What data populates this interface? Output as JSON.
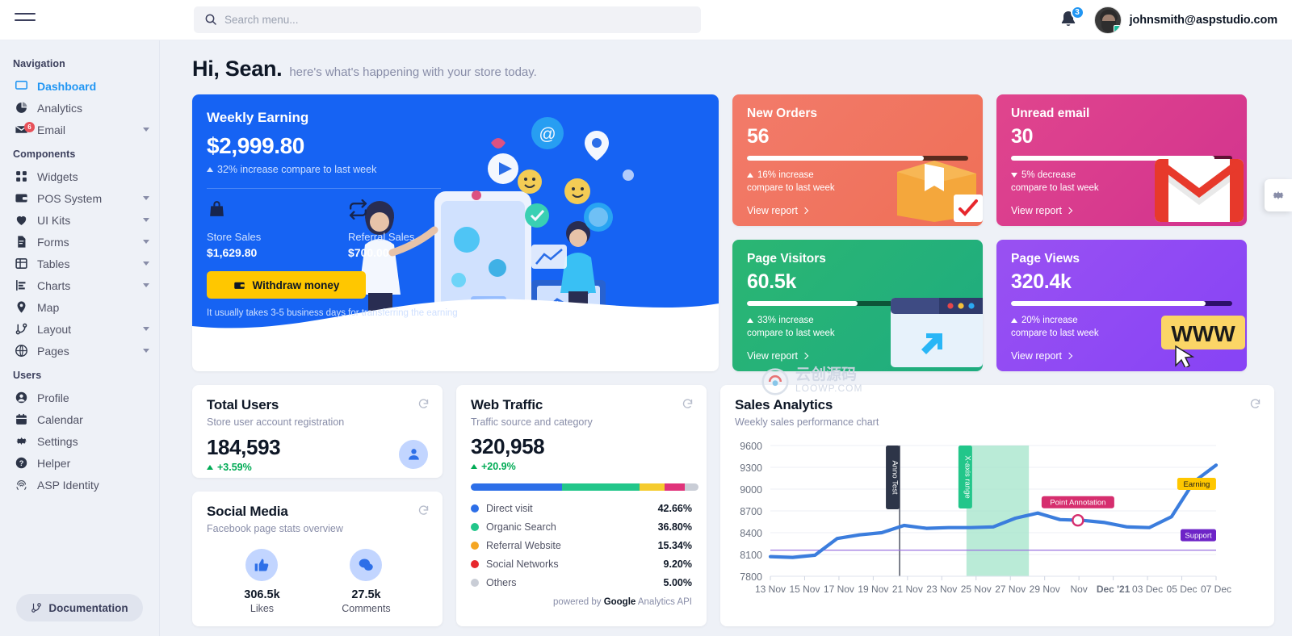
{
  "topbar": {
    "menu_icon": "hamburger-icon",
    "search_placeholder": "Search menu...",
    "search_value": "",
    "notification_count": "3",
    "user_email": "johnsmith@aspstudio.com"
  },
  "sidebar": {
    "sections": [
      {
        "label": "Navigation",
        "items": [
          {
            "label": "Dashboard",
            "icon": "monitor-icon",
            "active": true,
            "caret": false
          },
          {
            "label": "Analytics",
            "icon": "pie-chart-icon",
            "active": false,
            "caret": false
          },
          {
            "label": "Email",
            "icon": "mail-icon",
            "active": false,
            "caret": true,
            "badge": "6"
          }
        ]
      },
      {
        "label": "Components",
        "items": [
          {
            "label": "Widgets",
            "icon": "grid-icon",
            "active": false,
            "caret": false
          },
          {
            "label": "POS System",
            "icon": "wallet-icon",
            "active": false,
            "caret": true
          },
          {
            "label": "UI Kits",
            "icon": "heart-icon",
            "active": false,
            "caret": true
          },
          {
            "label": "Forms",
            "icon": "file-icon",
            "active": false,
            "caret": true
          },
          {
            "label": "Tables",
            "icon": "table-icon",
            "active": false,
            "caret": true
          },
          {
            "label": "Charts",
            "icon": "bar-chart-icon",
            "active": false,
            "caret": true
          },
          {
            "label": "Map",
            "icon": "map-pin-icon",
            "active": false,
            "caret": false
          },
          {
            "label": "Layout",
            "icon": "git-branch-icon",
            "active": false,
            "caret": true
          },
          {
            "label": "Pages",
            "icon": "globe-icon",
            "active": false,
            "caret": true
          }
        ]
      },
      {
        "label": "Users",
        "items": [
          {
            "label": "Profile",
            "icon": "user-circle-icon",
            "active": false,
            "caret": false
          },
          {
            "label": "Calendar",
            "icon": "calendar-icon",
            "active": false,
            "caret": false
          },
          {
            "label": "Settings",
            "icon": "gear-icon",
            "active": false,
            "caret": false
          },
          {
            "label": "Helper",
            "icon": "help-circle-icon",
            "active": false,
            "caret": false
          },
          {
            "label": "ASP Identity",
            "icon": "fingerprint-icon",
            "active": false,
            "caret": false
          }
        ]
      }
    ],
    "documentation_button": "Documentation"
  },
  "greeting": {
    "name": "Hi, Sean.",
    "subtitle": "here's what's happening with your store today."
  },
  "weekly_earning": {
    "title": "Weekly Earning",
    "amount": "$2,999.80",
    "change": "32% increase compare to last week",
    "store_sales_label": "Store Sales",
    "store_sales_value": "$1,629.80",
    "referral_sales_label": "Referral Sales",
    "referral_sales_value": "$700.00",
    "withdraw_button": "Withdraw money",
    "note": "It usually takes 3-5 business days for transferring the earning",
    "accent": "#1663f3",
    "button_color": "#ffc700"
  },
  "stat_cards": [
    {
      "title": "New Orders",
      "value": "56",
      "change_dir": "up",
      "change_line1": "16% increase",
      "change_line2": "compare to last week",
      "link": "View report",
      "progress": 80,
      "color_from": "#f27b6a",
      "color_to": "#ef6f57",
      "track": "#5a2b1e",
      "art": "box"
    },
    {
      "title": "Unread email",
      "value": "30",
      "change_dir": "down",
      "change_line1": "5% decrease",
      "change_line2": "compare to last week",
      "link": "View report",
      "progress": 92,
      "color_from": "#e0458d",
      "color_to": "#d2338f",
      "track": "#611235",
      "art": "mail"
    },
    {
      "title": "Page Visitors",
      "value": "60.5k",
      "change_dir": "up",
      "change_line1": "33% increase",
      "change_line2": "compare to last week",
      "link": "View report",
      "progress": 50,
      "color_from": "#2bb673",
      "color_to": "#1eac7f",
      "track": "#0d5438",
      "art": "browser"
    },
    {
      "title": "Page Views",
      "value": "320.4k",
      "change_dir": "up",
      "change_line1": "20% increase",
      "change_line2": "compare to last week",
      "link": "View report",
      "progress": 88,
      "color_from": "#9951f2",
      "color_to": "#8743f5",
      "track": "#2d1069",
      "art": "www"
    }
  ],
  "total_users": {
    "title": "Total Users",
    "subtitle": "Store user account registration",
    "value": "184,593",
    "change": "+3.59%",
    "icon": "user-icon"
  },
  "social_media": {
    "title": "Social Media",
    "subtitle": "Facebook page stats overview",
    "items": [
      {
        "value": "306.5k",
        "label": "Likes",
        "icon": "thumbs-up-icon"
      },
      {
        "value": "27.5k",
        "label": "Comments",
        "icon": "comment-icon"
      }
    ]
  },
  "web_traffic": {
    "title": "Web Traffic",
    "subtitle": "Traffic source and category",
    "value": "320,958",
    "change": "+20.9%",
    "footer": "powered by Google Analytics API",
    "footer_brand": "Google",
    "legend": [
      {
        "label": "Direct visit",
        "value": "42.66%",
        "color": "#2d6fe8",
        "pct": 42.66
      },
      {
        "label": "Organic Search",
        "value": "36.80%",
        "color": "#22c68a",
        "pct": 36.8
      },
      {
        "label": "Referral Website",
        "value": "15.34%",
        "color": "#f5a623",
        "pct": 15.34
      },
      {
        "label": "Social Networks",
        "value": "9.20%",
        "color": "#e7272d",
        "pct": 9.2
      },
      {
        "label": "Others",
        "value": "5.00%",
        "color": "#c9cdd6",
        "pct": 5.0
      }
    ],
    "bar_segments": [
      {
        "color": "#2d6fe8",
        "pct": 40
      },
      {
        "color": "#22c68a",
        "pct": 34
      },
      {
        "color": "#f5cb2e",
        "pct": 11
      },
      {
        "color": "#e0337a",
        "pct": 9
      },
      {
        "color": "#c9cdd6",
        "pct": 6
      }
    ]
  },
  "chart_data": {
    "type": "line",
    "title": "Sales Analytics",
    "subtitle": "Weekly sales performance chart",
    "xlabel": "",
    "ylabel": "",
    "ylim": [
      7800,
      9600
    ],
    "yticks": [
      9600,
      9300,
      9000,
      8700,
      8400,
      8100,
      7800
    ],
    "grid": true,
    "legend": "none",
    "line_color": "#3b7ddd",
    "categories": [
      "13 Nov",
      "15 Nov",
      "17 Nov",
      "19 Nov",
      "21 Nov",
      "23 Nov",
      "25 Nov",
      "27 Nov",
      "29 Nov",
      "Dec '21",
      "03 Dec",
      "05 Dec",
      "07 Dec"
    ],
    "x_tick_labels": [
      "13 Nov",
      "15 Nov",
      "17 Nov",
      "19 Nov",
      "21 Nov",
      "23 Nov",
      "25 Nov",
      "27 Nov",
      "29 Nov",
      "Nov",
      "Dec '21",
      "03 Dec",
      "05 Dec",
      "07 Dec"
    ],
    "series": [
      {
        "name": "Earning",
        "values": [
          8070,
          8060,
          8090,
          8320,
          8370,
          8400,
          8500,
          8460,
          8470,
          8470,
          8480,
          8600,
          8670,
          8580,
          8570,
          8540,
          8480,
          8470,
          8620,
          9100,
          9330
        ]
      }
    ],
    "annotations": [
      {
        "type": "x-line",
        "label": "Anno Test",
        "bg": "#2d3548",
        "text": "#ffffff",
        "x_pct": 29
      },
      {
        "type": "x-range",
        "label": "X-axis range",
        "bg": "#22c68a",
        "text": "#ffffff",
        "x_from_pct": 44,
        "x_to_pct": 58
      },
      {
        "type": "point",
        "label": "Point Annotation",
        "bg": "#d62e6e",
        "text": "#ffffff",
        "x_pct": 69,
        "y_value": 8570
      },
      {
        "type": "y-line",
        "label": "Support",
        "bg": "#6d24c7",
        "text": "#ffffff",
        "y_value": 8160
      },
      {
        "type": "series",
        "label": "Earning",
        "bg": "#ffc700",
        "text": "#1b1b1b",
        "x_pct": 96
      }
    ]
  },
  "watermark": {
    "line1": "云创源码",
    "line2": "LOOWP.COM"
  },
  "settings_fab": "gear-icon"
}
